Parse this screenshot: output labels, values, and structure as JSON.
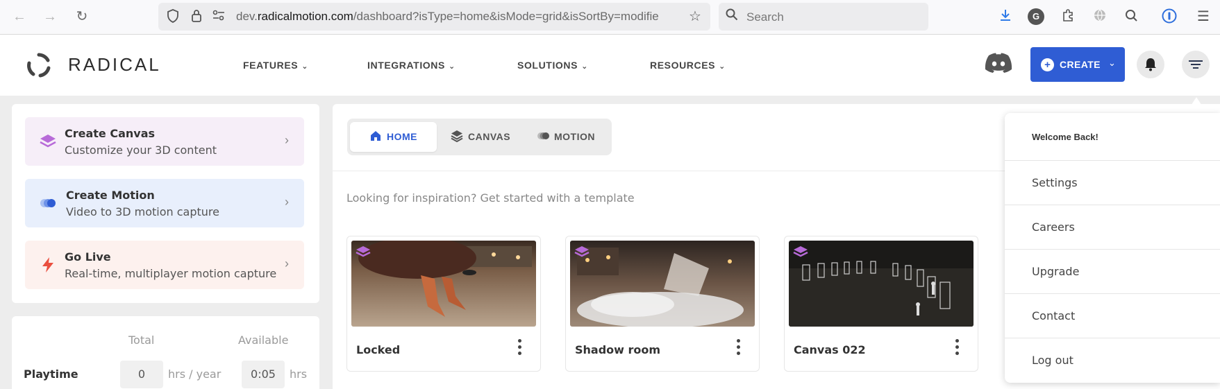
{
  "browser": {
    "url_prefix": "dev.",
    "url_domain": "radicalmotion.com",
    "url_path": "/dashboard?isType=home&isMode=grid&isSortBy=modifie",
    "search_placeholder": "Search",
    "extension_g_label": "G"
  },
  "header": {
    "logo_text": "RADICAL",
    "nav": [
      {
        "label": "FEATURES"
      },
      {
        "label": "INTEGRATIONS"
      },
      {
        "label": "SOLUTIONS"
      },
      {
        "label": "RESOURCES"
      }
    ],
    "create_label": "CREATE",
    "brand_color": "#2f5dd4"
  },
  "sidebar": {
    "actions": [
      {
        "title": "Create Canvas",
        "subtitle": "Customize your 3D content",
        "bg": "#f6eef8",
        "icon": "layers-icon"
      },
      {
        "title": "Create Motion",
        "subtitle": "Video to 3D motion capture",
        "bg": "#e8effc",
        "icon": "motion-icon"
      },
      {
        "title": "Go Live",
        "subtitle": "Real-time, multiplayer motion capture",
        "bg": "#fdf1ee",
        "icon": "lightning-icon"
      }
    ],
    "usage": {
      "col_total": "Total",
      "col_available": "Available",
      "row_label": "Playtime",
      "total_value": "0",
      "total_unit": "hrs / year",
      "available_value": "0:05",
      "available_unit": "hrs"
    }
  },
  "main": {
    "tabs": [
      {
        "label": "HOME",
        "active": true
      },
      {
        "label": "CANVAS",
        "active": false
      },
      {
        "label": "MOTION",
        "active": false
      }
    ],
    "inspiration_text": "Looking for inspiration? Get started with a template",
    "templates": [
      {
        "name": "Locked"
      },
      {
        "name": "Shadow room"
      },
      {
        "name": "Canvas 022"
      }
    ]
  },
  "user_menu": {
    "welcome": "Welcome Back!",
    "items": [
      {
        "label": "Settings"
      },
      {
        "label": "Careers"
      },
      {
        "label": "Upgrade"
      },
      {
        "label": "Contact"
      },
      {
        "label": "Log out"
      }
    ]
  }
}
